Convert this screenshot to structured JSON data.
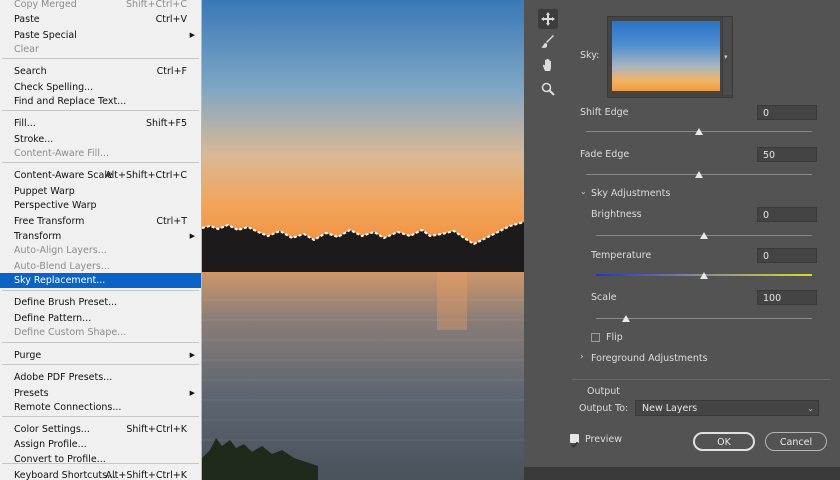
{
  "menu": {
    "items": [
      {
        "label": "Copy Merged",
        "shortcut": "Shift+Ctrl+C",
        "disabled": true
      },
      {
        "label": "Paste",
        "shortcut": "Ctrl+V"
      },
      {
        "label": "Paste Special",
        "submenu": true
      },
      {
        "label": "Clear",
        "disabled": true
      },
      {
        "label": "Search",
        "shortcut": "Ctrl+F"
      },
      {
        "label": "Check Spelling..."
      },
      {
        "label": "Find and Replace Text..."
      },
      {
        "label": "Fill...",
        "shortcut": "Shift+F5"
      },
      {
        "label": "Stroke..."
      },
      {
        "label": "Content-Aware Fill...",
        "disabled": true
      },
      {
        "label": "Content-Aware Scale",
        "shortcut": "Alt+Shift+Ctrl+C"
      },
      {
        "label": "Puppet Warp"
      },
      {
        "label": "Perspective Warp"
      },
      {
        "label": "Free Transform",
        "shortcut": "Ctrl+T"
      },
      {
        "label": "Transform",
        "submenu": true
      },
      {
        "label": "Auto-Align Layers...",
        "disabled": true
      },
      {
        "label": "Auto-Blend Layers...",
        "disabled": true
      },
      {
        "label": "Sky Replacement...",
        "selected": true
      },
      {
        "label": "Define Brush Preset..."
      },
      {
        "label": "Define Pattern..."
      },
      {
        "label": "Define Custom Shape...",
        "disabled": true
      },
      {
        "label": "Purge",
        "submenu": true
      },
      {
        "label": "Adobe PDF Presets..."
      },
      {
        "label": "Presets",
        "submenu": true
      },
      {
        "label": "Remote Connections..."
      },
      {
        "label": "Color Settings...",
        "shortcut": "Shift+Ctrl+K"
      },
      {
        "label": "Assign Profile..."
      },
      {
        "label": "Convert to Profile..."
      },
      {
        "label": "Keyboard Shortcuts...",
        "shortcut": "Alt+Shift+Ctrl+K"
      }
    ]
  },
  "dialog": {
    "sky_label": "Sky:",
    "shift_edge": {
      "label": "Shift Edge",
      "value": "0",
      "level": 0.5
    },
    "fade_edge": {
      "label": "Fade Edge",
      "value": "50",
      "level": 0.5
    },
    "sky_adjustments": {
      "label": "Sky Adjustments"
    },
    "brightness": {
      "label": "Brightness",
      "value": "0",
      "level": 0.5
    },
    "temperature": {
      "label": "Temperature",
      "value": "0",
      "level": 0.5
    },
    "scale": {
      "label": "Scale",
      "value": "100",
      "level": 0.14
    },
    "flip": {
      "label": "Flip",
      "checked": false
    },
    "foreground_adjustments": {
      "label": "Foreground Adjustments"
    },
    "output": {
      "section_label": "Output",
      "output_to_label": "Output To:",
      "output_to_value": "New Layers"
    },
    "preview": {
      "label": "Preview",
      "checked": true
    },
    "ok_label": "OK",
    "cancel_label": "Cancel"
  },
  "colors": {
    "selection": "#0a64c8",
    "dialog_bg": "#535353",
    "menu_bg": "#f0f0f0"
  }
}
